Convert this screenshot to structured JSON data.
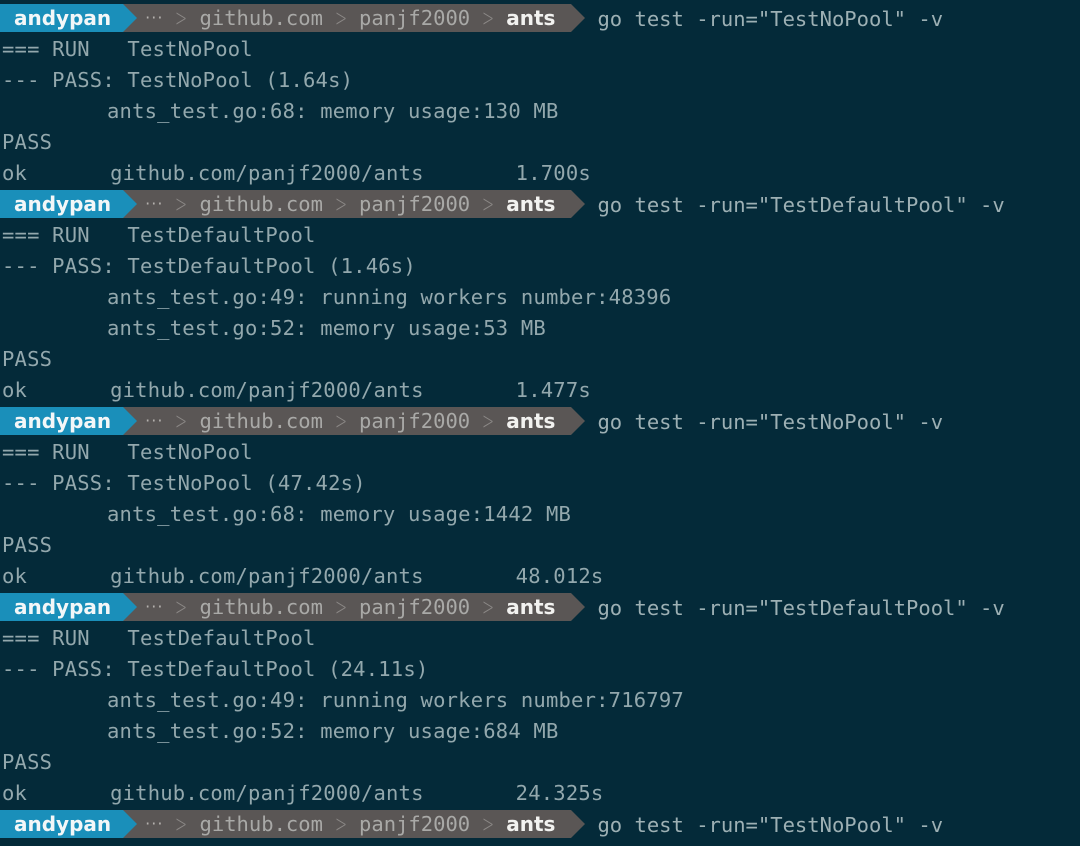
{
  "theme": {
    "background": "#042a39",
    "text": "#93a8ad",
    "prompt_user_bg": "#1a8fba",
    "prompt_path_bg": "#5a5655",
    "prompt_current_text": "#f2f2f0"
  },
  "prompt": {
    "user": "andypan",
    "ellipsis": "···",
    "path": [
      "github.com",
      "panjf2000"
    ],
    "current_dir": "ants"
  },
  "runs": [
    {
      "command": "go test -run=\"TestNoPool\" -v",
      "run_line": "=== RUN   TestNoPool",
      "pass_line": "--- PASS: TestNoPool (1.64s)",
      "logs": [
        "ants_test.go:68: memory usage:130 MB"
      ],
      "status": "PASS",
      "ok_label": "ok",
      "package": "github.com/panjf2000/ants",
      "duration": "1.700s"
    },
    {
      "command": "go test -run=\"TestDefaultPool\" -v",
      "run_line": "=== RUN   TestDefaultPool",
      "pass_line": "--- PASS: TestDefaultPool (1.46s)",
      "logs": [
        "ants_test.go:49: running workers number:48396",
        "ants_test.go:52: memory usage:53 MB"
      ],
      "status": "PASS",
      "ok_label": "ok",
      "package": "github.com/panjf2000/ants",
      "duration": "1.477s"
    },
    {
      "command": "go test -run=\"TestNoPool\" -v",
      "run_line": "=== RUN   TestNoPool",
      "pass_line": "--- PASS: TestNoPool (47.42s)",
      "logs": [
        "ants_test.go:68: memory usage:1442 MB"
      ],
      "status": "PASS",
      "ok_label": "ok",
      "package": "github.com/panjf2000/ants",
      "duration": "48.012s"
    },
    {
      "command": "go test -run=\"TestDefaultPool\" -v",
      "run_line": "=== RUN   TestDefaultPool",
      "pass_line": "--- PASS: TestDefaultPool (24.11s)",
      "logs": [
        "ants_test.go:49: running workers number:716797",
        "ants_test.go:52: memory usage:684 MB"
      ],
      "status": "PASS",
      "ok_label": "ok",
      "package": "github.com/panjf2000/ants",
      "duration": "24.325s"
    }
  ],
  "final_prompt": {
    "command": "go test -run=\"TestNoPool\" -v"
  }
}
